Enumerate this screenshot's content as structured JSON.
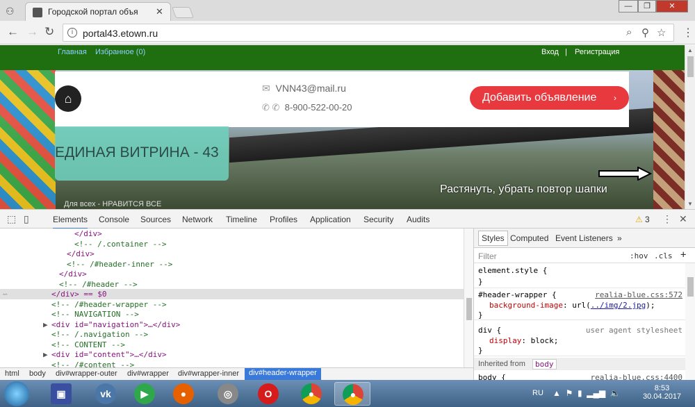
{
  "browser": {
    "tab_title": "Городской портал объя",
    "tab_close": "✕",
    "url": "portal43.etown.ru",
    "window_controls": {
      "minimize": "—",
      "maximize": "❐",
      "close": "✕"
    }
  },
  "site": {
    "nav_home": "Главная",
    "nav_favorites": "Избранное (0)",
    "login": "Вход",
    "separator": "|",
    "register": "Регистрация",
    "email": "VNN43@mail.ru",
    "phone": "8-900-522-00-20",
    "add_button": "Добавить объявление",
    "add_button_chevron": "›",
    "title": "ЕДИНАЯ ВИТРИНА - 43",
    "annotation": "Растянуть, убрать повтор шапки",
    "bottom_text": "Для всех - НРАВИТСЯ ВСЕ"
  },
  "devtools": {
    "tabs": [
      "Elements",
      "Console",
      "Sources",
      "Network",
      "Timeline",
      "Profiles",
      "Application",
      "Security",
      "Audits"
    ],
    "warnings": "3",
    "dom_lines": [
      {
        "text": "</div>",
        "kind": "tag"
      },
      {
        "text": "<!-- /.container -->",
        "kind": "cmt"
      },
      {
        "text": "</div>",
        "kind": "tag"
      },
      {
        "text": "<!-- /#header-inner -->",
        "kind": "cmt"
      },
      {
        "text": "</div>",
        "kind": "tag"
      },
      {
        "text": "<!-- /#header -->",
        "kind": "cmt"
      },
      {
        "text": "</div> == $0",
        "kind": "sel"
      },
      {
        "text": "<!-- /#header-wrapper -->",
        "kind": "cmt"
      },
      {
        "text": "<!-- NAVIGATION -->",
        "kind": "cmt"
      },
      {
        "text": "<div id=\"navigation\">…</div>",
        "kind": "node"
      },
      {
        "text": "<!-- /.navigation -->",
        "kind": "cmt"
      },
      {
        "text": "<!-- CONTENT -->",
        "kind": "cmt"
      },
      {
        "text": "<div id=\"content\">…</div>",
        "kind": "node"
      },
      {
        "text": "<!-- /#content -->",
        "kind": "cmt"
      }
    ],
    "breadcrumb": [
      "html",
      "body",
      "div#wrapper-outer",
      "div#wrapper",
      "div#wrapper-inner",
      "div#header-wrapper"
    ],
    "styles_tabs": [
      "Styles",
      "Computed",
      "Event Listeners",
      "»"
    ],
    "filter_placeholder": "Filter",
    "filter_hov": ":hov",
    "filter_cls": ".cls",
    "filter_plus": "+",
    "rules": {
      "element_style_open": "element.style {",
      "element_style_close": "}",
      "header_selector": "#header-wrapper {",
      "header_source": "realia-blue.css:572",
      "header_prop": "background-image",
      "header_value_pre": ": url(",
      "header_value_link": "../img/2.jpg",
      "header_value_post": ");",
      "header_close": "}",
      "div_selector": "div {",
      "div_source": "user agent stylesheet",
      "div_prop": "display",
      "div_value": ": block;",
      "div_close": "}",
      "inherited_label": "Inherited from",
      "inherited_el": "body",
      "body_selector": "body {",
      "body_source": "realia-blue.css:4400"
    }
  },
  "taskbar": {
    "lang": "RU",
    "time": "8:53",
    "date": "30.04.2017",
    "apps": [
      "save-app",
      "vk",
      "player",
      "firefox",
      "dvd",
      "opera",
      "chrome",
      "chrome-active"
    ]
  },
  "colors": {
    "green_bar": "#1f6e0f",
    "add_button": "#e8393f",
    "devtools_accent": "#3879d9"
  }
}
